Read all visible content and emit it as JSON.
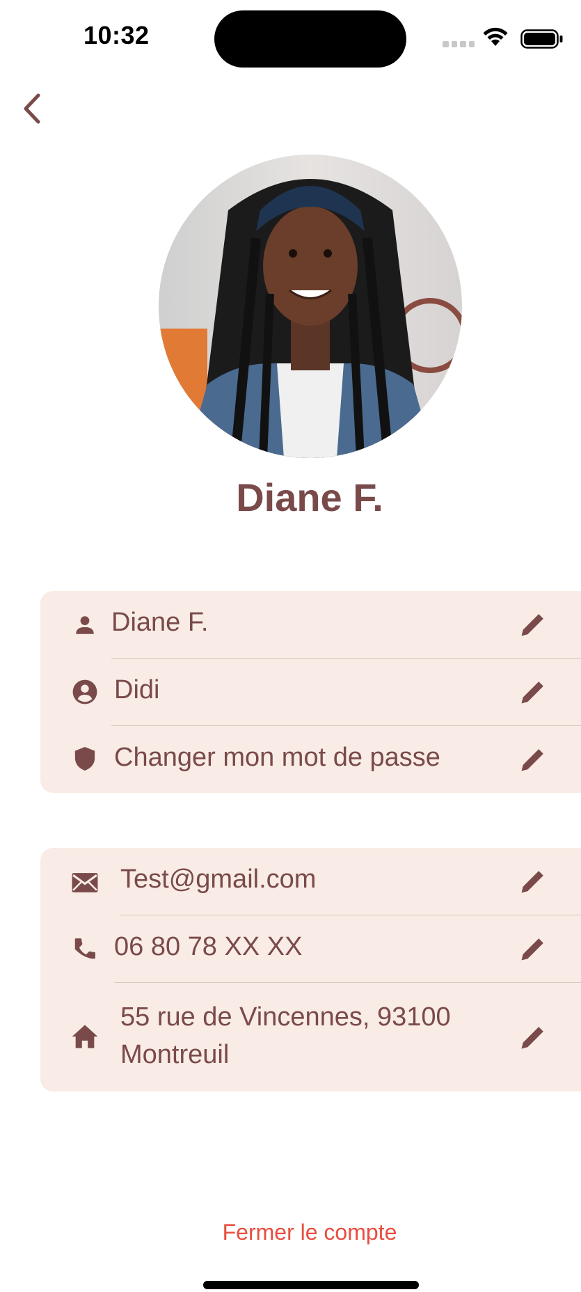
{
  "status_bar": {
    "time": "10:32"
  },
  "profile": {
    "name": "Diane F."
  },
  "account_card": {
    "rows": [
      {
        "icon": "person-icon",
        "label": "Diane F."
      },
      {
        "icon": "account-circle-icon",
        "label": "Didi"
      },
      {
        "icon": "shield-icon",
        "label": "Changer mon mot de passe"
      }
    ]
  },
  "contact_card": {
    "rows": [
      {
        "icon": "mail-icon",
        "label": "Test@gmail.com"
      },
      {
        "icon": "phone-icon",
        "label": "06 80 78 XX XX"
      },
      {
        "icon": "home-icon",
        "label": "55 rue de Vincennes, 93100 Montreuil"
      }
    ]
  },
  "footer": {
    "close_account_label": "Fermer le compte"
  },
  "colors": {
    "accent": "#7a4a4a",
    "card_background": "#f9ece6",
    "danger": "#e84e3e"
  }
}
